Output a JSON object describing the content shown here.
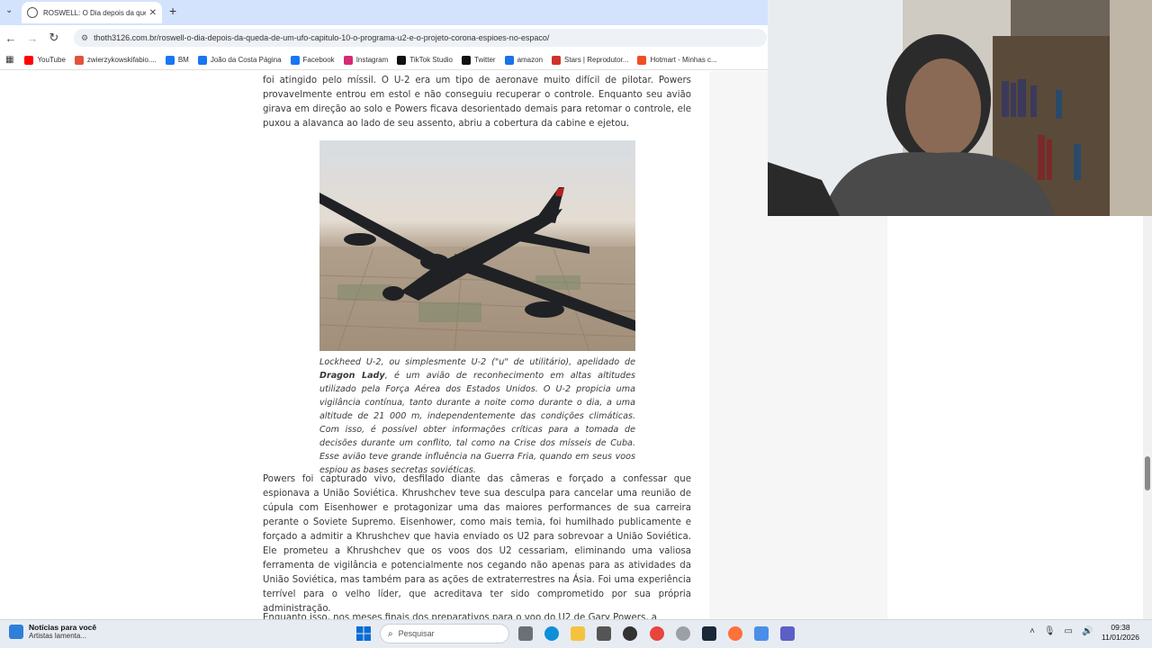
{
  "browser": {
    "tab_title": "ROSWELL: O Dia depois da que",
    "url": "thoth3126.com.br/roswell-o-dia-depois-da-queda-de-um-ufo-capitulo-10-o-programa-u2-e-o-projeto-corona-espioes-no-espaco/",
    "bookmarks": [
      {
        "label": "YouTube",
        "icon": "youtube-icon",
        "color": "#ff0000"
      },
      {
        "label": "zwierzykowskifabio....",
        "icon": "flame-icon",
        "color": "#e2533a"
      },
      {
        "label": "BM",
        "icon": "meta-icon",
        "color": "#1877f2"
      },
      {
        "label": "João da Costa Página",
        "icon": "facebook-icon",
        "color": "#1877f2"
      },
      {
        "label": "Facebook",
        "icon": "facebook-icon",
        "color": "#1877f2"
      },
      {
        "label": "Instagram",
        "icon": "instagram-icon",
        "color": "#d62976"
      },
      {
        "label": "TikTok Studio",
        "icon": "tiktok-icon",
        "color": "#111111"
      },
      {
        "label": "Twitter",
        "icon": "x-icon",
        "color": "#111111"
      },
      {
        "label": "amazon",
        "icon": "amazon-icon",
        "color": "#1a73e8"
      },
      {
        "label": "Stars | Reprodutor...",
        "icon": "star-icon",
        "color": "#d0312d"
      },
      {
        "label": "Hotmart - Minhas c...",
        "icon": "hotmart-icon",
        "color": "#f04e23"
      }
    ]
  },
  "article": {
    "para1": "foi atingido pelo míssil. O U-2 era um tipo de aeronave muito difícil de pilotar. Powers provavelmente entrou em estol e não conseguiu recuperar o controle. Enquanto seu avião girava em direção ao solo e Powers ficava desorientado demais para retomar o controle, ele puxou a alavanca ao lado de seu assento, abriu a cobertura da cabine e ejetou.",
    "caption_pre": "Lockheed U-2, ou simplesmente U-2 (\"u\" de utilitário), apelidado de ",
    "caption_bold": "Dragon Lady",
    "caption_post": ", é um avião de reconhecimento em altas altitudes utilizado pela Força Aérea dos Estados Unidos. O U-2 propicia uma vigilância contínua, tanto durante a noite como durante o dia, a uma altitude de 21 000 m, independentemente das condições climáticas. Com isso, é possível obter informações críticas para a tomada de decisões durante um conflito, tal como na Crise dos mísseis de Cuba. Esse avião teve grande influência na Guerra Fria, quando em seus voos espiou as bases secretas soviéticas.",
    "para2": "Powers foi capturado vivo, desfilado diante das câmeras e forçado a confessar que espionava a União Soviética. Khrushchev teve sua desculpa para cancelar uma reunião de cúpula com Eisenhower e protagonizar uma das maiores performances de sua carreira perante o Soviete Supremo. Eisenhower, como mais temia, foi humilhado publicamente e forçado a admitir a Khrushchev que havia enviado os U2 para sobrevoar a União Soviética. Ele prometeu a Khrushchev que os voos dos U2 cessariam, eliminando uma valiosa ferramenta de vigilância e potencialmente nos cegando não apenas para as atividades da União Soviética, mas também para as ações de extraterrestres na Ásia. Foi uma experiência terrível para o velho líder, que acreditava ter sido comprometido por sua própria administração.",
    "para3": "Enquanto isso, nos meses finais dos preparativos para o voo do U2 de Gary Powers, a"
  },
  "taskbar": {
    "news_title": "Notícias para você",
    "news_sub": "Artistas lamenta...",
    "search_placeholder": "Pesquisar",
    "time": "09:38",
    "date": "11/01/2026"
  }
}
